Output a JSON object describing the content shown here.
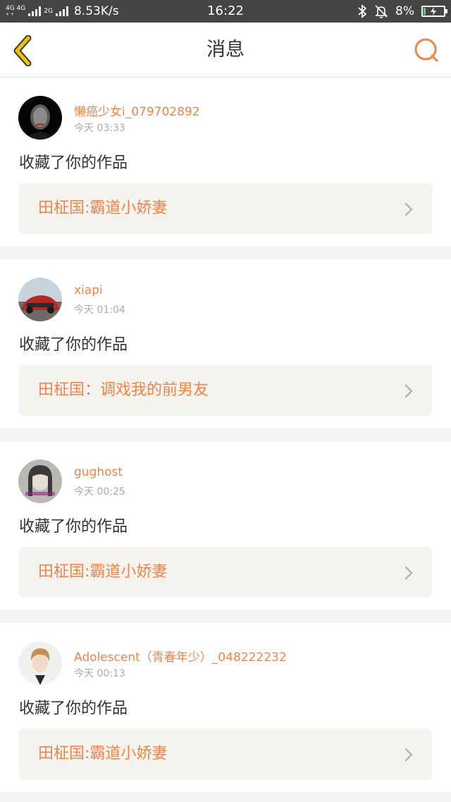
{
  "status_bar": {
    "network_1": "4G 4G",
    "network_1_sub": "+ +",
    "network_2": "2G",
    "speed": "8.53K/s",
    "time": "16:22",
    "battery": "8%"
  },
  "header": {
    "title": "消息",
    "back_icon": "chevron-left-icon",
    "search_icon": "search-icon"
  },
  "colors": {
    "accent": "#f0834a",
    "back_arrow": "#f2c200",
    "status_bar": "#454545",
    "card_link_bg": "#f5f3ee"
  },
  "messages": [
    {
      "username": "懒癌少女i_079702892",
      "time": "今天 03:33",
      "action": "收藏了你的作品",
      "work": "田柾国:霸道小娇妻"
    },
    {
      "username": "xiapi",
      "time": "今天 01:04",
      "action": "收藏了你的作品",
      "work": "田柾国：调戏我的前男友"
    },
    {
      "username": "gughost",
      "time": "今天 00:25",
      "action": "收藏了你的作品",
      "work": "田柾国:霸道小娇妻"
    },
    {
      "username": "Adolescent（青春年少）_048222232",
      "time": "今天 00:13",
      "action": "收藏了你的作品",
      "work": "田柾国:霸道小娇妻"
    }
  ]
}
